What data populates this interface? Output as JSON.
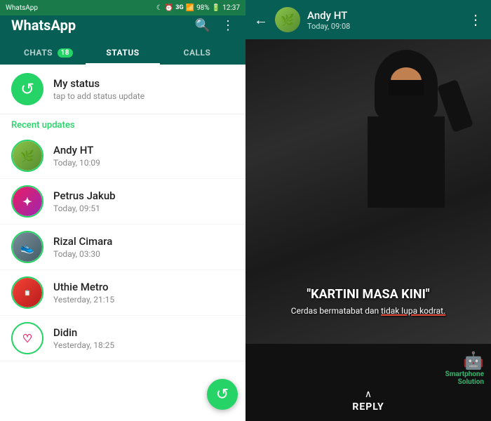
{
  "statusBar": {
    "left": "WhatsApp",
    "carrier": "3G",
    "signal": "▋▋▋",
    "battery": "98%",
    "time": "12:37"
  },
  "header": {
    "title": "WhatsApp",
    "searchIcon": "🔍",
    "moreIcon": "⋮"
  },
  "tabs": [
    {
      "id": "chats",
      "label": "CHATS",
      "badge": "18",
      "active": false
    },
    {
      "id": "status",
      "label": "STATUS",
      "badge": "",
      "active": true
    },
    {
      "id": "calls",
      "label": "CALLS",
      "badge": "",
      "active": false
    }
  ],
  "myStatus": {
    "name": "My status",
    "sub": "tap to add status update"
  },
  "recentLabel": "Recent updates",
  "contacts": [
    {
      "id": "andyht",
      "name": "Andy HT",
      "time": "Today, 10:09",
      "avatarType": "leaf"
    },
    {
      "id": "petrus",
      "name": "Petrus Jakub",
      "time": "Today, 09:51",
      "avatarType": "pink"
    },
    {
      "id": "rizal",
      "name": "Rizal Cimara",
      "time": "Today, 03:30",
      "avatarType": "shoes"
    },
    {
      "id": "uthie",
      "name": "Uthie Metro",
      "time": "Yesterday, 21:15",
      "avatarType": "red"
    },
    {
      "id": "didin",
      "name": "Didin",
      "time": "Yesterday, 18:25",
      "avatarType": "heart"
    }
  ],
  "fab": {
    "icon": "↺",
    "label": "refresh-status"
  },
  "chat": {
    "contactName": "Andy HT",
    "contactTime": "Today, 09:08",
    "backIcon": "←",
    "moreIcon": "⋮",
    "meme": {
      "title": "\"KARTINI MASA KINI\"",
      "subtitle": "Cerdas bermatabat dan tidak lupa kodrat.",
      "underlineStart": 24,
      "underlineText": "tidak lupa kodrat"
    },
    "watermarkLine1": "Smartphone",
    "watermarkLine2": "Solution",
    "replyLabel": "REPLY"
  }
}
